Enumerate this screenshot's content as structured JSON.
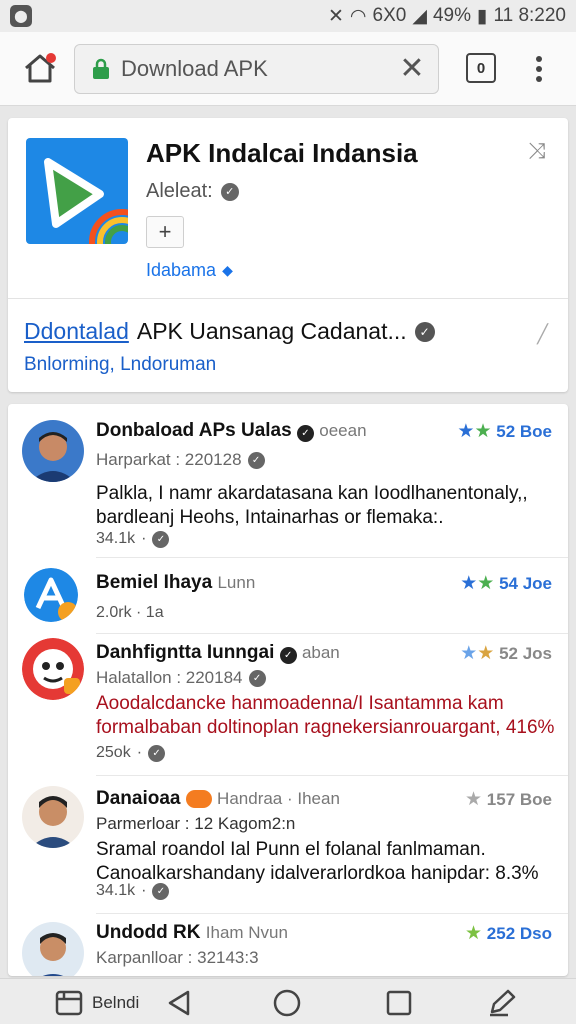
{
  "status_bar": {
    "battery": "49%",
    "network": "6X0",
    "time": "11 8:220"
  },
  "browser": {
    "url_text": "Download APK",
    "tab_count": "0"
  },
  "app_card": {
    "title": "APK Indalcai Indansia",
    "subtitle": "Aleleat:",
    "developer": "Idabama",
    "download_link": "Ddontalad",
    "download_rest": "APK Uansanag Cadanat...",
    "download_sub": "Bnlorming, Lndoruman",
    "icon_colors": [
      "#1e88e5",
      "#43a047",
      "#f4511e"
    ]
  },
  "items": [
    {
      "title": "Donbaload APs Ualas",
      "tag": "oeean",
      "rating": "52 Boe",
      "meta": "Harparkat : 220128",
      "desc": "Palkla, I namr akardatasana kan Ioodlhanentonaly,, bardleanj Heohs, Intainarhas or flemaka:.",
      "desc_color": "normal",
      "count": "34.1k"
    },
    {
      "title": "Bemiel Ihaya",
      "tag": "Lunn",
      "rating": "54 Joe",
      "meta": "",
      "desc": "",
      "desc_color": "normal",
      "count": "2.0rk · 1a"
    },
    {
      "title": "Danhfigntta Iunngai",
      "tag": "aban",
      "rating": "52 Jos",
      "meta": "Halatallon : 220184",
      "desc": "Aoodalcdancke hanmoadenna/I Isantamma kam formalbaban doltinoplan ragnekersianrouargant, 416%",
      "desc_color": "red",
      "count": "25ok"
    },
    {
      "title": "Danaioaa",
      "tag": "Handraa · Ihean",
      "rating": "157 Boe",
      "meta": "Parmerloar : 12 Kagom2:n",
      "desc": "Sramal roandol Ial Punn el folanal fanlmaman. Canoalkarshandany idalverarlordkoa hanipdar: 8.3%",
      "desc_color": "normal",
      "count": "34.1k"
    },
    {
      "title": "Undodd RK",
      "tag": "Iham Nvun",
      "rating": "252 Dso",
      "meta": "Karpanlloar : 32143:3",
      "desc": "",
      "desc_color": "normal",
      "count": ""
    }
  ],
  "bottom_nav": {
    "label": "Belndi"
  }
}
